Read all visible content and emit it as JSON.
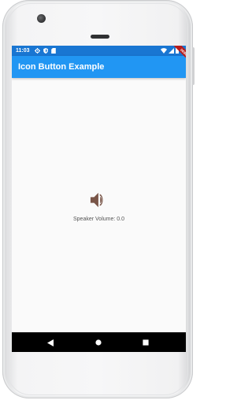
{
  "status_bar": {
    "time": "11:03",
    "left_icons": [
      "gear-icon",
      "shield-icon",
      "sd-card-icon"
    ],
    "right_icons": [
      "wifi-icon",
      "signal-icon",
      "battery-icon"
    ],
    "color": "#1976d2"
  },
  "app_bar": {
    "title": "Icon Button Example",
    "color": "#2196f3",
    "debug_banner": "DEBUG"
  },
  "content": {
    "volume_button_icon": "volume-up-icon",
    "volume_icon_color": "#795548",
    "volume_text": "Speaker Volume: 0.0"
  },
  "nav_bar": {
    "buttons": [
      "back-icon",
      "home-icon",
      "recents-icon"
    ]
  }
}
